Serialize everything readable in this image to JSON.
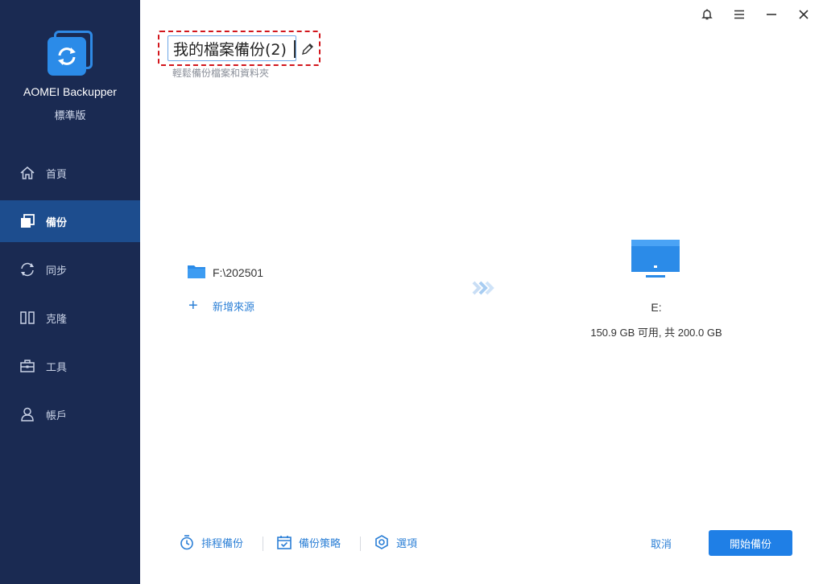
{
  "app": {
    "name": "AOMEI Backupper",
    "edition": "標準版"
  },
  "sidebar": {
    "items": [
      {
        "label": "首頁",
        "icon": "home-icon",
        "active": false
      },
      {
        "label": "備份",
        "icon": "backup-icon",
        "active": true
      },
      {
        "label": "同步",
        "icon": "sync-icon",
        "active": false
      },
      {
        "label": "克隆",
        "icon": "clone-icon",
        "active": false
      },
      {
        "label": "工具",
        "icon": "toolbox-icon",
        "active": false
      },
      {
        "label": "帳戶",
        "icon": "user-icon",
        "active": false
      }
    ]
  },
  "titlebar": {
    "icons": [
      "bell-icon",
      "menu-icon",
      "minimize-icon",
      "close-icon"
    ]
  },
  "task": {
    "name": "我的檔案備份(2)",
    "subtitle": "輕鬆備份檔案和資料夾"
  },
  "source": {
    "path": "F:\\202501",
    "add_label": "新增來源"
  },
  "destination": {
    "name": "E:",
    "capacity": "150.9 GB 可用, 共 200.0 GB"
  },
  "bottom": {
    "schedule_label": "排程備份",
    "scheme_label": "備份策略",
    "options_label": "選項",
    "cancel_label": "取消",
    "start_label": "開始備份"
  },
  "colors": {
    "sidebar_bg": "#1a2a52",
    "sidebar_active": "#1d4d8e",
    "accent": "#1f7fe6",
    "highlight_border": "#d2161c"
  }
}
